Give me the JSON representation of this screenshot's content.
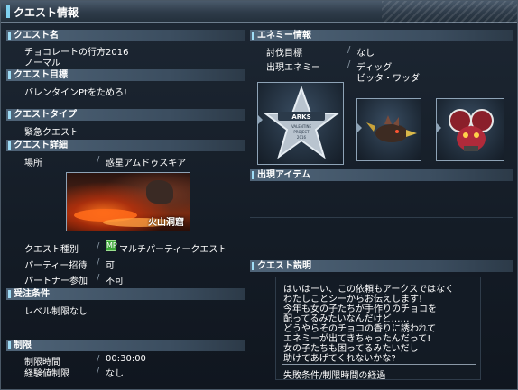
{
  "window": {
    "title": "クエスト情報"
  },
  "left": {
    "quest_name": {
      "header": "クエスト名",
      "name": "チョコレートの行方2016",
      "difficulty": "ノーマル"
    },
    "quest_goal": {
      "header": "クエスト目標",
      "text": "バレンタインPtをためろ!"
    },
    "quest_type": {
      "header": "クエストタイプ",
      "text": "緊急クエスト"
    },
    "quest_detail": {
      "header": "クエスト詳細",
      "location_label": "場所",
      "location_value": "惑星アムドゥスキア",
      "location_area": "火山洞窟",
      "rows": [
        {
          "label": "クエスト種別",
          "value": "マルチパーティークエスト",
          "icon": "multi-party-icon",
          "icon_text": "MP"
        },
        {
          "label": "パーティー招待",
          "value": "可"
        },
        {
          "label": "パートナー参加",
          "value": "不可"
        }
      ]
    },
    "requirements": {
      "header": "受注条件",
      "text": "レベル制限なし"
    },
    "limits": {
      "header": "制限",
      "rows": [
        {
          "label": "制限時間",
          "value": "00:30:00"
        },
        {
          "label": "経験値制限",
          "value": "なし"
        }
      ]
    }
  },
  "right": {
    "enemy_info": {
      "header": "エネミー情報",
      "target_label": "討伐目標",
      "target_value": "なし",
      "appear_label": "出現エネミー",
      "appear_values": [
        "ディッグ",
        "ビッタ・ワッダ"
      ],
      "badge_text": [
        "ARKS",
        "VALENTINE",
        "PROJECT",
        "2016"
      ]
    },
    "items": {
      "header": "出現アイテム"
    },
    "description": {
      "header": "クエスト説明",
      "lines": [
        "はいはーい、この依頼もアークスではなく",
        "わたしことシーからお伝えします!",
        "今年も女の子たちが手作りのチョコを",
        "配ってるみたいなんだけど……",
        "どうやらそのチョコの香りに誘われて",
        "エネミーが出てきちゃったんだって!",
        "女の子たちも困ってるみたいだし",
        "助けてあげてくれないかな?"
      ],
      "fail_condition": "失敗条件/制限時間の経過"
    }
  },
  "colors": {
    "accent": "#9fdcf5",
    "header_bg": "#4f6478",
    "panel_bg": "#141c26"
  }
}
